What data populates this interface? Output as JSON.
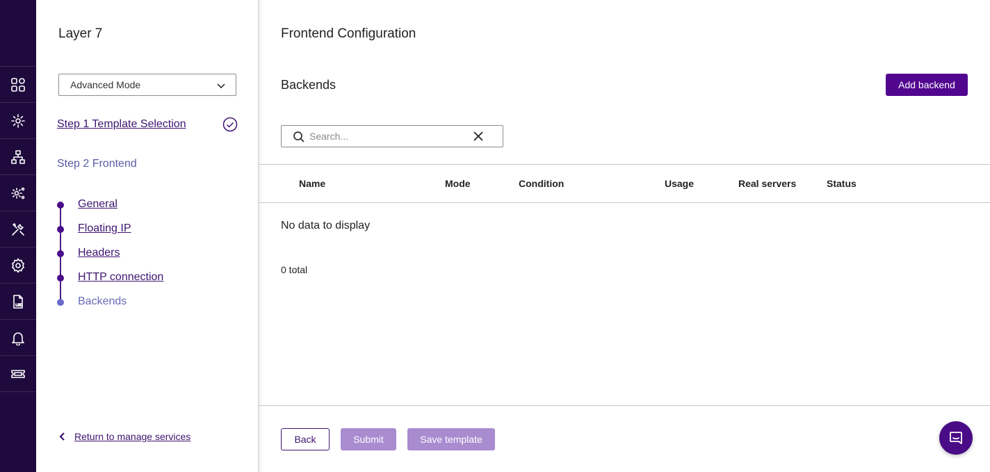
{
  "rail": {
    "items": [
      {
        "icon": "dashboard-grid-icon"
      },
      {
        "icon": "services-gear-icon"
      },
      {
        "icon": "network-icon"
      },
      {
        "icon": "settings-cog-icon"
      },
      {
        "icon": "tools-icon"
      },
      {
        "icon": "gear-icon"
      },
      {
        "icon": "log-file-icon"
      },
      {
        "icon": "bell-icon"
      },
      {
        "icon": "ticket-icon"
      }
    ]
  },
  "sidebar": {
    "title": "Layer 7",
    "mode_select": {
      "value": "Advanced Mode"
    },
    "step1": {
      "label": "Step 1 Template Selection"
    },
    "step2": {
      "label": "Step 2 Frontend"
    },
    "sub_steps": [
      {
        "label": "General"
      },
      {
        "label": "Floating IP"
      },
      {
        "label": "Headers"
      },
      {
        "label": "HTTP connection"
      },
      {
        "label": "Backends"
      }
    ],
    "return_link": "Return to manage services"
  },
  "main": {
    "page_title": "Frontend Configuration",
    "section_title": "Backends",
    "add_button": "Add backend",
    "search": {
      "placeholder": "Search...",
      "value": ""
    },
    "table": {
      "columns": [
        "Name",
        "Mode",
        "Condition",
        "Usage",
        "Real servers",
        "Status"
      ],
      "rows": [],
      "empty_message": "No data to display",
      "total": "0 total"
    },
    "footer": {
      "back": "Back",
      "submit": "Submit",
      "save_template": "Save template"
    }
  },
  "colors": {
    "rail_bg": "#1e0a3c",
    "primary": "#52068f",
    "primary_disabled": "#a98bd0",
    "link": "#3d1470",
    "current_step": "#6a6ab8"
  }
}
